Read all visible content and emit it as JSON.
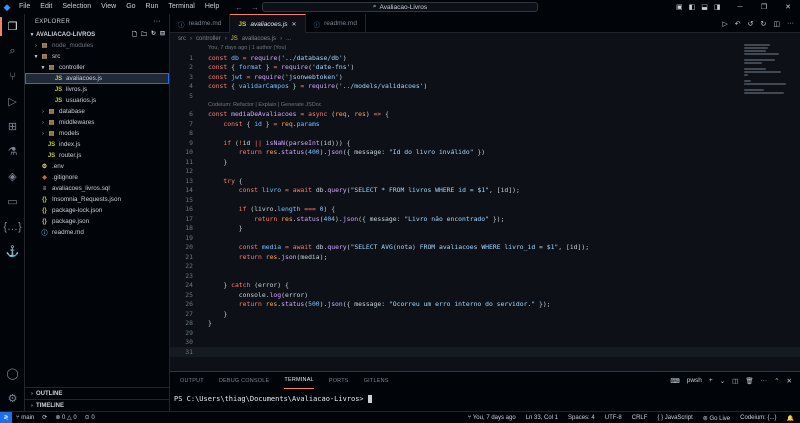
{
  "menu": [
    "File",
    "Edit",
    "Selection",
    "View",
    "Go",
    "Run",
    "Terminal",
    "Help"
  ],
  "search": {
    "text": "Avaliacao-Livros"
  },
  "sidebar": {
    "title": "EXPLORER",
    "project": "AVALIACAO-LIVROS",
    "tree": [
      {
        "label": "node_modules",
        "type": "folder",
        "depth": 1,
        "open": false,
        "dim": true
      },
      {
        "label": "src",
        "type": "folder",
        "depth": 1,
        "open": true
      },
      {
        "label": "controller",
        "type": "folder",
        "depth": 2,
        "open": true
      },
      {
        "label": "avaliacoes.js",
        "type": "js",
        "depth": 3,
        "selected": true
      },
      {
        "label": "livros.js",
        "type": "js",
        "depth": 3
      },
      {
        "label": "usuarios.js",
        "type": "js",
        "depth": 3
      },
      {
        "label": "database",
        "type": "folder",
        "depth": 2,
        "open": false
      },
      {
        "label": "middlewares",
        "type": "folder",
        "depth": 2,
        "open": false
      },
      {
        "label": "models",
        "type": "folder",
        "depth": 2,
        "open": false
      },
      {
        "label": "index.js",
        "type": "js",
        "depth": 2
      },
      {
        "label": "router.js",
        "type": "js",
        "depth": 2
      },
      {
        "label": ".env",
        "type": "env",
        "depth": 1
      },
      {
        "label": ".gitignore",
        "type": "git",
        "depth": 1
      },
      {
        "label": "avaliacoes_livros.sql",
        "type": "sql",
        "depth": 1
      },
      {
        "label": "Insomnia_Requests.json",
        "type": "json",
        "depth": 1
      },
      {
        "label": "package-lock.json",
        "type": "json",
        "depth": 1
      },
      {
        "label": "package.json",
        "type": "json",
        "depth": 1
      },
      {
        "label": "readme.md",
        "type": "md",
        "depth": 1
      }
    ],
    "sections": [
      "OUTLINE",
      "TIMELINE"
    ]
  },
  "tabs": [
    {
      "label": "readme.md",
      "active": false
    },
    {
      "label": "avaliacoes.js",
      "active": true
    },
    {
      "label": "readme.md",
      "active": false
    }
  ],
  "breadcrumb": [
    "src",
    "controller",
    "avaliacoes.js",
    "..."
  ],
  "lens": {
    "blame": "You, 7 days ago | 1 author (You)",
    "codeium": "Codeium: Refactor | Explain | Generate JSDoc"
  },
  "code_lines": [
    {
      "n": "1",
      "html": "<span class='k'>const</span> <span class='v'>db</span> <span class='k'>=</span> <span class='f'>require</span>(<span class='s'>'../database/db'</span>)"
    },
    {
      "n": "2",
      "html": "<span class='k'>const</span> { <span class='v'>format</span> } <span class='k'>=</span> <span class='f'>require</span>(<span class='s'>'date-fns'</span>)"
    },
    {
      "n": "3",
      "html": "<span class='k'>const</span> <span class='v'>jwt</span> <span class='k'>=</span> <span class='f'>require</span>(<span class='s'>'jsonwebtoken'</span>)"
    },
    {
      "n": "4",
      "html": "<span class='k'>const</span> { <span class='v'>validarCampos</span> } <span class='k'>=</span> <span class='f'>require</span>(<span class='s'>'../models/validacoes'</span>)"
    },
    {
      "n": "5",
      "html": "",
      "lens": true
    },
    {
      "n": "6",
      "html": "<span class='k'>const</span> <span class='f'>mediaDeAvaliacoes</span> <span class='k'>=</span> <span class='k'>async</span> (<span class='p'>req</span>, <span class='p'>res</span>) <span class='k'>=&gt;</span> {"
    },
    {
      "n": "7",
      "html": "    <span class='k'>const</span> { <span class='v'>id</span> } <span class='k'>=</span> <span class='p'>req</span>.<span class='v'>params</span>"
    },
    {
      "n": "8",
      "html": ""
    },
    {
      "n": "9",
      "html": "    <span class='k'>if</span> (<span class='k'>!</span><span class='b'>id</span> <span class='k'>||</span> <span class='f'>isNaN</span>(<span class='f'>parseInt</span>(<span class='b'>id</span>))) {"
    },
    {
      "n": "10",
      "html": "        <span class='k'>return</span> <span class='p'>res</span>.<span class='f'>status</span>(<span class='n'>400</span>).<span class='f'>json</span>({ <span class='b'>message</span>: <span class='s'>\"Id do livro inválido\"</span> })"
    },
    {
      "n": "11",
      "html": "    }"
    },
    {
      "n": "12",
      "html": ""
    },
    {
      "n": "13",
      "html": "    <span class='k'>try</span> {"
    },
    {
      "n": "14",
      "html": "        <span class='k'>const</span> <span class='v'>livro</span> <span class='k'>=</span> <span class='k'>await</span> <span class='b'>db</span>.<span class='f'>query</span>(<span class='s'>\"SELECT * FROM livros WHERE id = $1\"</span>, [<span class='b'>id</span>]);"
    },
    {
      "n": "15",
      "html": ""
    },
    {
      "n": "16",
      "html": "        <span class='k'>if</span> (<span class='b'>livro</span>.<span class='v'>length</span> <span class='k'>===</span> <span class='n'>0</span>) {"
    },
    {
      "n": "17",
      "html": "            <span class='k'>return</span> <span class='p'>res</span>.<span class='f'>status</span>(<span class='n'>404</span>).<span class='f'>json</span>({ <span class='b'>message</span>: <span class='s'>\"Livro não encontrado\"</span> });"
    },
    {
      "n": "18",
      "html": "        }"
    },
    {
      "n": "19",
      "html": ""
    },
    {
      "n": "20",
      "html": "        <span class='k'>const</span> <span class='v'>media</span> <span class='k'>=</span> <span class='k'>await</span> <span class='b'>db</span>.<span class='f'>query</span>(<span class='s'>\"SELECT AVG(nota) FROM avaliacoes WHERE livro_id = $1\"</span>, [<span class='b'>id</span>]);"
    },
    {
      "n": "21",
      "html": "        <span class='k'>return</span> <span class='p'>res</span>.<span class='f'>json</span>(<span class='b'>media</span>);"
    },
    {
      "n": "22",
      "html": ""
    },
    {
      "n": "23",
      "html": ""
    },
    {
      "n": "24",
      "html": "    } <span class='k'>catch</span> (<span class='b'>error</span>) {"
    },
    {
      "n": "25",
      "html": "        <span class='b'>console</span>.<span class='f'>log</span>(<span class='b'>error</span>)"
    },
    {
      "n": "26",
      "html": "        <span class='k'>return</span> <span class='p'>res</span>.<span class='f'>status</span>(<span class='n'>500</span>).<span class='f'>json</span>({ <span class='b'>message</span>: <span class='s'>\"Ocorreu um erro interno do servidor.\"</span> });"
    },
    {
      "n": "27",
      "html": "    }"
    },
    {
      "n": "28",
      "html": "}"
    },
    {
      "n": "29",
      "html": ""
    },
    {
      "n": "30",
      "html": ""
    },
    {
      "n": "31",
      "html": "",
      "current": true
    }
  ],
  "panel": {
    "tabs": [
      "OUTPUT",
      "DEBUG CONSOLE",
      "TERMINAL",
      "PORTS",
      "GITLENS"
    ],
    "active_tab": "TERMINAL",
    "shell": "pwsh",
    "prompt": "PS C:\\Users\\thiag\\Documents\\Avaliacao-Livros>"
  },
  "status": {
    "branch": "main",
    "sync": "⟳",
    "errors": "0",
    "warnings": "0",
    "ports": "0",
    "blame": "You, 7 days ago",
    "position": "Ln 33, Col 1",
    "spaces": "Spaces: 4",
    "encoding": "UTF-8",
    "eol": "CRLF",
    "language": "JavaScript",
    "golive": "Go Live",
    "codeium": "Codeium: {...}"
  },
  "colors": {
    "accent": "#f78166",
    "bg": "#0d1117",
    "sidebar_bg": "#010409"
  }
}
